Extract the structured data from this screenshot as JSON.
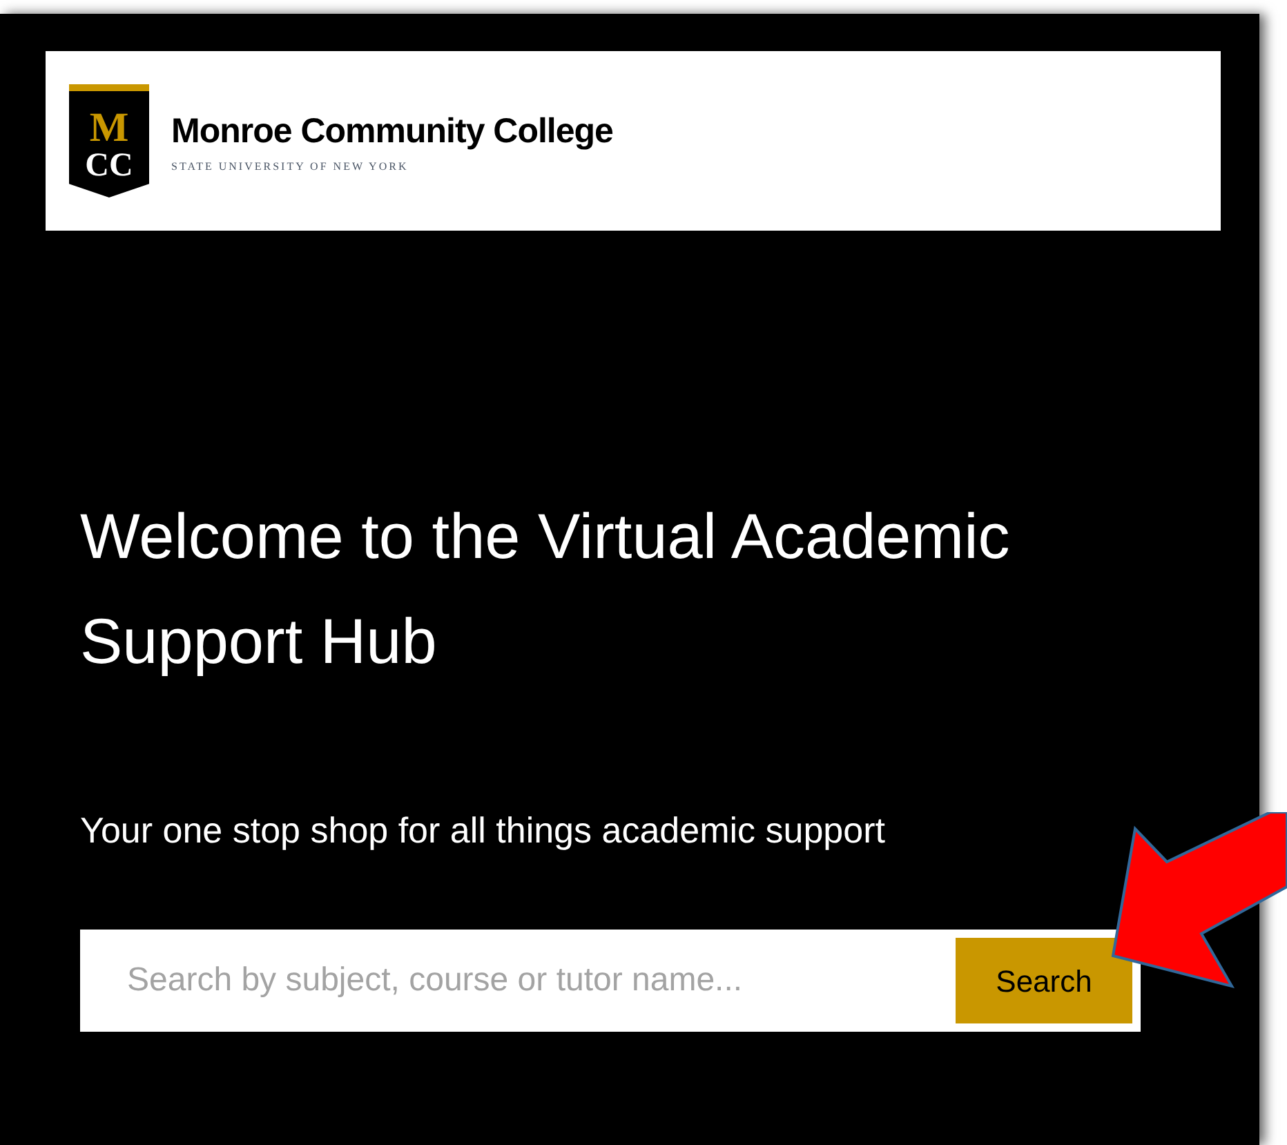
{
  "header": {
    "logo_letters": [
      "M",
      "CC"
    ],
    "college_name": "Monroe Community College",
    "tagline": "STATE UNIVERSITY OF NEW YORK"
  },
  "hero": {
    "title": "Welcome to the Virtual Academic Support Hub",
    "subtitle": "Your one stop shop for all things academic support"
  },
  "search": {
    "placeholder": "Search by subject, course or tutor name...",
    "button": "Search"
  }
}
